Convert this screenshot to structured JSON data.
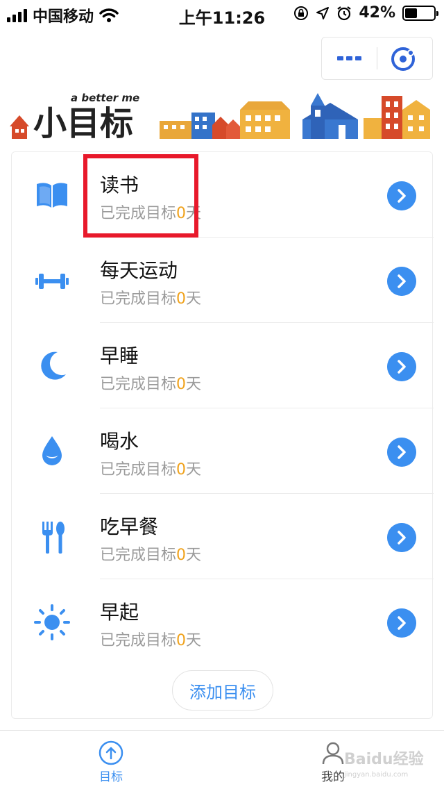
{
  "status_bar": {
    "carrier": "中国移动",
    "time": "上午11:26",
    "battery_percent": "42%",
    "battery_level": 0.42
  },
  "capsule": {
    "more_icon": "more-dots-icon",
    "close_icon": "target-close-icon"
  },
  "banner": {
    "tagline": "a better me",
    "logo_text": "小目标"
  },
  "goals": [
    {
      "title": "读书",
      "progress_prefix": "已完成目标",
      "days": "0",
      "progress_suffix": "天",
      "icon": "book-icon"
    },
    {
      "title": "每天运动",
      "progress_prefix": "已完成目标",
      "days": "0",
      "progress_suffix": "天",
      "icon": "dumbbell-icon"
    },
    {
      "title": "早睡",
      "progress_prefix": "已完成目标",
      "days": "0",
      "progress_suffix": "天",
      "icon": "moon-icon"
    },
    {
      "title": "喝水",
      "progress_prefix": "已完成目标",
      "days": "0",
      "progress_suffix": "天",
      "icon": "water-drop-icon"
    },
    {
      "title": "吃早餐",
      "progress_prefix": "已完成目标",
      "days": "0",
      "progress_suffix": "天",
      "icon": "fork-spoon-icon"
    },
    {
      "title": "早起",
      "progress_prefix": "已完成目标",
      "days": "0",
      "progress_suffix": "天",
      "icon": "sun-icon"
    }
  ],
  "add_goal_label": "添加目标",
  "tabs": [
    {
      "label": "目标",
      "icon": "arrow-up-circle-icon",
      "active": true
    },
    {
      "label": "我的",
      "icon": "user-icon",
      "active": false
    }
  ],
  "colors": {
    "accent": "#3b8ff0",
    "highlight": "#f0a31e",
    "annotation": "#e8192b"
  },
  "watermark": {
    "text": "Baidu经验",
    "subtext": "jingyan.baidu.com"
  }
}
